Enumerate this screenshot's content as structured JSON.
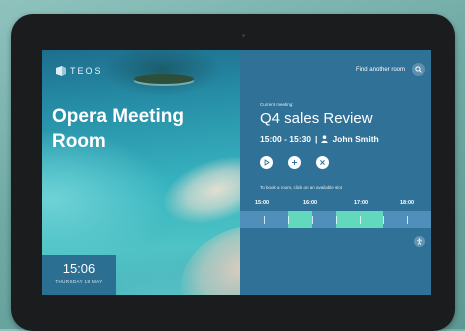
{
  "brand": {
    "logo_text": "TEOS"
  },
  "room": {
    "name": "Opera Meeting Room"
  },
  "clock": {
    "time": "15:06",
    "date": "THURSDAY 18 MAY"
  },
  "header": {
    "find_room_label": "Find another room",
    "search_icon": "search-icon"
  },
  "meeting": {
    "label": "Current meeting:",
    "title": "Q4 sales Review",
    "time": "15:00 - 15:30",
    "separator": "|",
    "organizer": "John Smith"
  },
  "actions": [
    {
      "name": "start",
      "icon": "play-icon"
    },
    {
      "name": "extend",
      "icon": "plus-icon"
    },
    {
      "name": "end",
      "icon": "close-icon"
    }
  ],
  "booking": {
    "hint": "To book a room, click on an available slot",
    "hours": [
      "15:00",
      "16:00",
      "17:00",
      "18:00"
    ]
  },
  "colors": {
    "panel": "#2f7197",
    "track": "#4f8fba",
    "available_slot": "#62d8bf",
    "bezel": "#1b1c1e"
  },
  "accessibility": {
    "icon": "accessibility-icon"
  }
}
